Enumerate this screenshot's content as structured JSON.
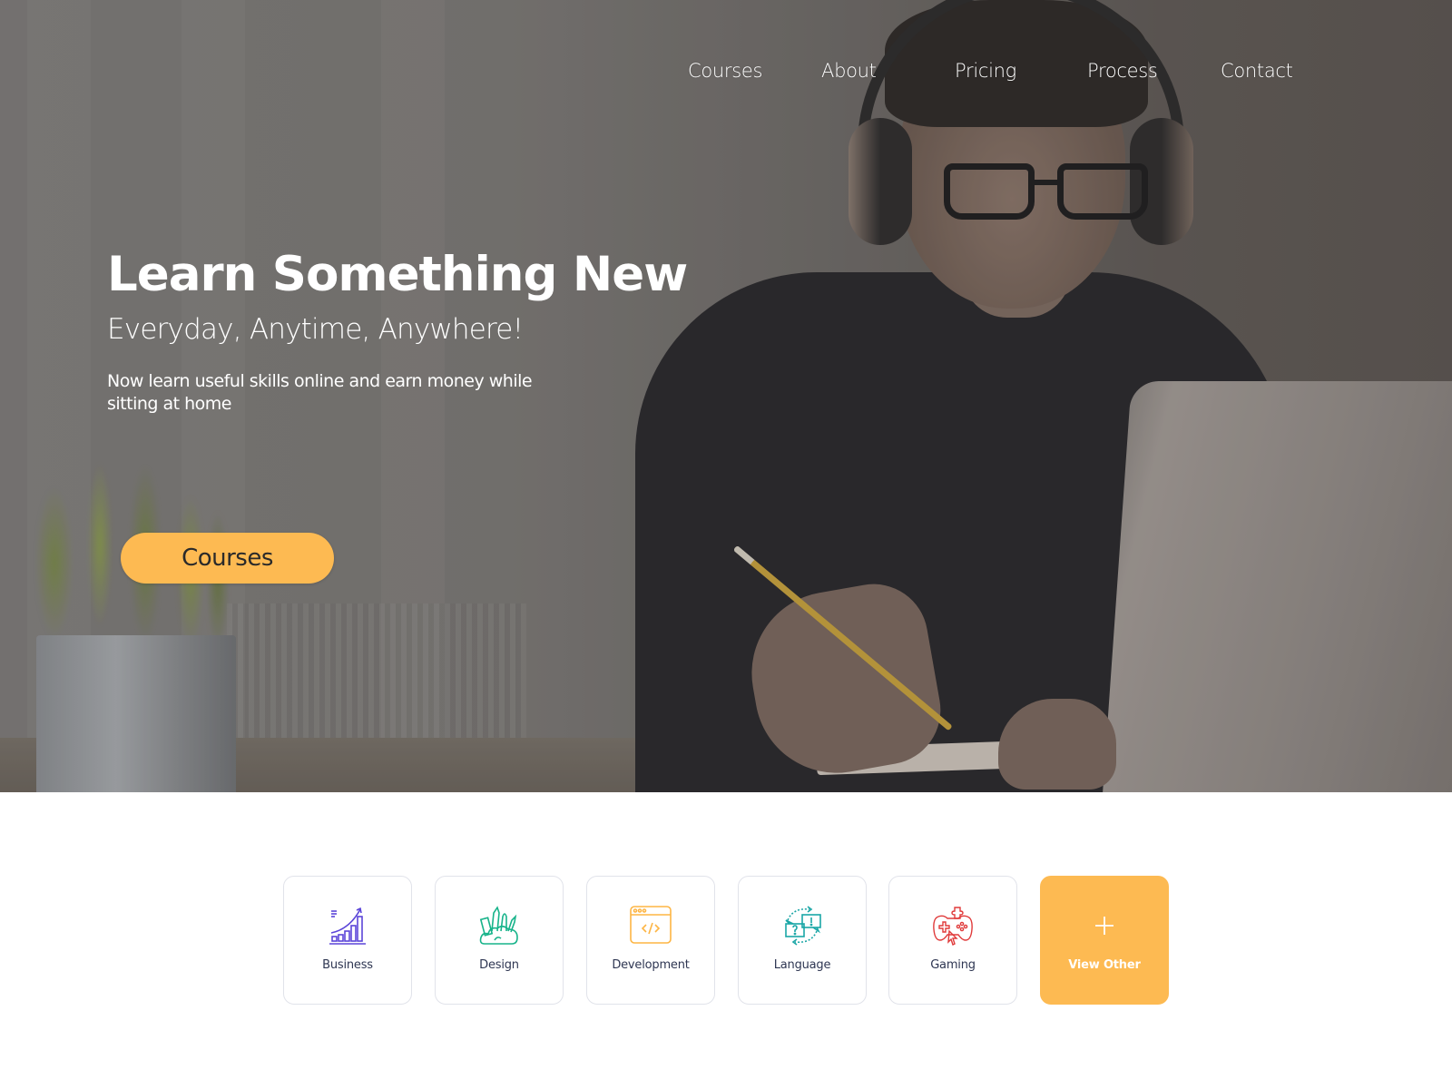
{
  "nav": {
    "items": [
      {
        "label": "Courses"
      },
      {
        "label": "About"
      },
      {
        "label": "Pricing"
      },
      {
        "label": "Process"
      },
      {
        "label": "Contact"
      }
    ]
  },
  "hero": {
    "title": "Learn Something New",
    "subtitle": "Everyday, Anytime, Anywhere!",
    "description": "Now learn useful skills online and earn money while sitting at home",
    "cta_label": "Courses",
    "background_image": "student-with-headphones-studying-at-laptop"
  },
  "categories": {
    "items": [
      {
        "label": "Business",
        "icon": "bar-chart-growth-icon",
        "color": "#5b45d8"
      },
      {
        "label": "Design",
        "icon": "design-tools-icon",
        "color": "#17b38a"
      },
      {
        "label": "Development",
        "icon": "code-window-icon",
        "color": "#fdb544"
      },
      {
        "label": "Language",
        "icon": "speech-exchange-icon",
        "color": "#1aa6a6"
      },
      {
        "label": "Gaming",
        "icon": "gamepad-icon",
        "color": "#e03a3a"
      },
      {
        "label": "View Other",
        "icon": "plus-icon",
        "color": "#ffffff"
      }
    ]
  },
  "colors": {
    "accent": "#fdba52",
    "card_border": "#e1e3ea",
    "card_label": "#2e3652"
  }
}
